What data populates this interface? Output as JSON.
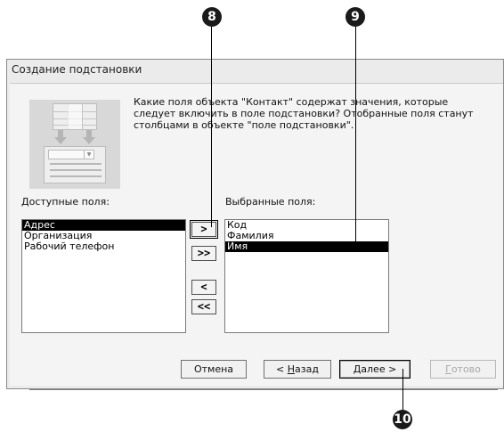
{
  "callouts": [
    "8",
    "9",
    "10"
  ],
  "window": {
    "title": "Создание подстановки"
  },
  "description": "Какие поля объекта \"Контакт\" содержат значения, которые следует включить в поле подстановки? Отобранные поля станут столбцами в объекте \"поле подстановки\".",
  "available": {
    "label": "Доступные поля:",
    "items": [
      "Адрес",
      "Организация",
      "Рабочий телефон"
    ],
    "selected_index": 0
  },
  "selected": {
    "label": "Выбранные поля:",
    "items": [
      "Код",
      "Фамилия",
      "Имя"
    ],
    "selected_index": 2
  },
  "move_buttons": {
    "add_one": ">",
    "add_all": ">>",
    "remove_one": "<",
    "remove_all": "<<"
  },
  "footer": {
    "cancel": "Отмена",
    "back_prefix": "< ",
    "back_hotkey": "Н",
    "back_rest": "азад",
    "next_hotkey": "Д",
    "next_rest": "алее >",
    "finish_hotkey": "Г",
    "finish_rest": "отово"
  }
}
